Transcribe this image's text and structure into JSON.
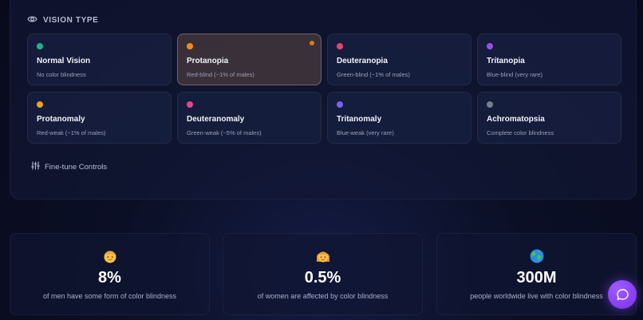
{
  "vision": {
    "header": "VISION TYPE",
    "selected_index": 1,
    "types": [
      {
        "name": "Normal Vision",
        "desc": "No color blindness",
        "color": "#1fb38a"
      },
      {
        "name": "Protanopia",
        "desc": "Red-blind (~1% of males)",
        "color": "#f08c1a"
      },
      {
        "name": "Deuteranopia",
        "desc": "Green-blind (~1% of males)",
        "color": "#e8456e"
      },
      {
        "name": "Tritanopia",
        "desc": "Blue-blind (very rare)",
        "color": "#9b4ee8"
      },
      {
        "name": "Protanomaly",
        "desc": "Red-weak (~1% of males)",
        "color": "#f0a320"
      },
      {
        "name": "Deuteranomaly",
        "desc": "Green-weak (~5% of males)",
        "color": "#e8448c"
      },
      {
        "name": "Tritanomaly",
        "desc": "Blue-weak (very rare)",
        "color": "#7a62f0"
      },
      {
        "name": "Achromatopsia",
        "desc": "Complete color blindness",
        "color": "#7a7e8c"
      }
    ],
    "finetune_label": "Fine-tune Controls"
  },
  "stats": [
    {
      "value": "8%",
      "label": "of men have some form of color blindness",
      "icon": "man-emoji-icon"
    },
    {
      "value": "0.5%",
      "label": "of women are affected by color blindness",
      "icon": "woman-emoji-icon"
    },
    {
      "value": "300M",
      "label": "people worldwide live with color blindness",
      "icon": "globe-emoji-icon"
    }
  ],
  "colors": {
    "accent": "#8b3ff0",
    "selected_marker": "#d97a12"
  }
}
